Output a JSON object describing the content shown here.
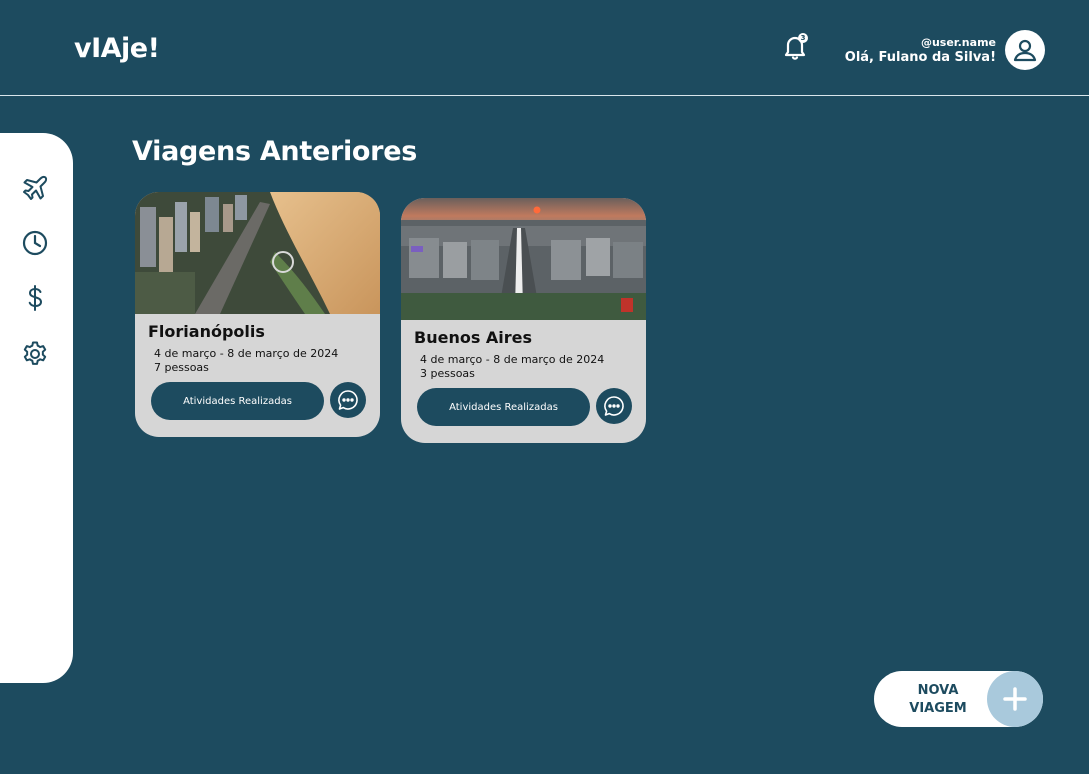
{
  "header": {
    "logo": "vIAje!",
    "notifications_count": "3",
    "username": "@user.name",
    "greeting": "Olá, Fulano da Silva!"
  },
  "sidebar": {
    "items": [
      {
        "icon": "airplane-icon"
      },
      {
        "icon": "clock-icon"
      },
      {
        "icon": "dollar-icon"
      },
      {
        "icon": "gear-icon"
      }
    ]
  },
  "main": {
    "title": "Viagens Anteriores",
    "trips": [
      {
        "city": "Florianópolis",
        "dates": "4 de março - 8 de março de 2024",
        "people": "7 pessoas",
        "button_label": "Atividades Realizadas",
        "image": "city-beach-photo"
      },
      {
        "city": "Buenos Aires",
        "dates": "4 de março - 8 de março de 2024",
        "people": "3 pessoas",
        "button_label": "Atividades Realizadas",
        "image": "city-sunset-photo"
      }
    ]
  },
  "fab": {
    "label_line1": "NOVA",
    "label_line2": "VIAGEM"
  },
  "colors": {
    "background": "#1d4b5f",
    "card": "#d6d6d6",
    "accent": "#a9c9dc",
    "white": "#ffffff"
  }
}
